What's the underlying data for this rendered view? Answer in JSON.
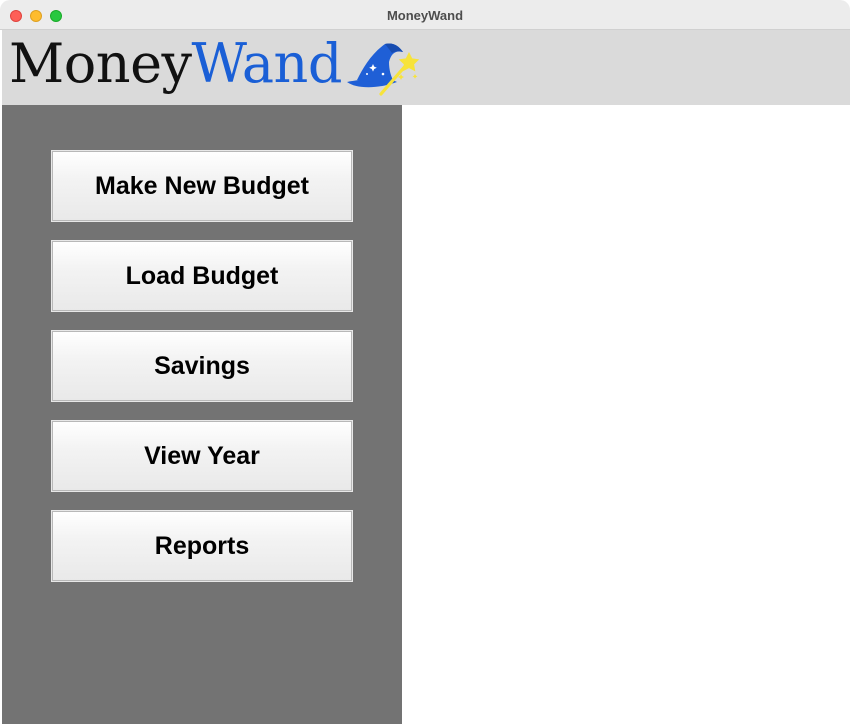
{
  "window": {
    "title": "MoneyWand"
  },
  "header": {
    "logo_part1": "Money",
    "logo_part2": "Wand",
    "logo_icon": "wizard-hat-wand-icon"
  },
  "colors": {
    "logo_accent": "#1a5fd6",
    "header_bg": "#dadada",
    "sidebar_bg": "#737373",
    "content_bg": "#ffffff",
    "hat_blue": "#1f5fd6",
    "wand_star": "#f7e33a"
  },
  "sidebar": {
    "buttons": [
      {
        "label": "Make New Budget"
      },
      {
        "label": "Load Budget"
      },
      {
        "label": "Savings"
      },
      {
        "label": "View Year"
      },
      {
        "label": "Reports"
      }
    ]
  }
}
